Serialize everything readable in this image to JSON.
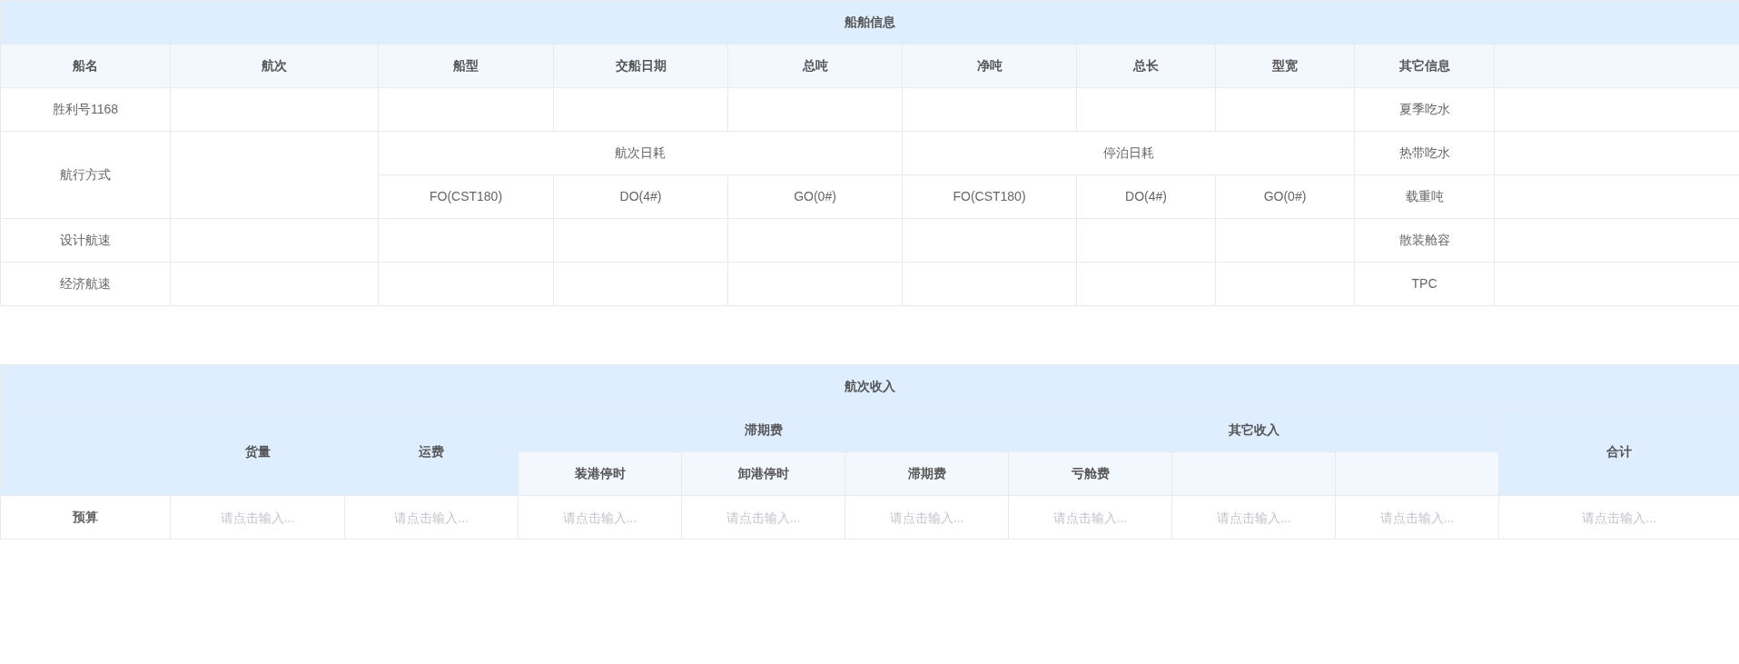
{
  "ship_info": {
    "title": "船舶信息",
    "columns": [
      "船名",
      "航次",
      "船型",
      "交船日期",
      "总吨",
      "净吨",
      "总长",
      "型宽",
      "其它信息"
    ],
    "rows": [
      {
        "kind": "plain",
        "label": "胜利号1168",
        "other": "夏季吃水"
      },
      {
        "kind": "consumption",
        "label": "航行方式",
        "groups": [
          {
            "title": "航次日耗",
            "fuels": [
              "FO(CST180)",
              "DO(4#)",
              "GO(0#)"
            ]
          },
          {
            "title": "停泊日耗",
            "fuels": [
              "FO(CST180)",
              "DO(4#)",
              "GO(0#)"
            ]
          }
        ],
        "others": [
          "热带吃水",
          "载重吨"
        ]
      },
      {
        "kind": "plain",
        "label": "设计航速",
        "other": "散装舱容"
      },
      {
        "kind": "plain",
        "label": "经济航速",
        "other": "TPC"
      }
    ]
  },
  "voyage_income": {
    "title": "航次收入",
    "columns": [
      {
        "kind": "single",
        "label": "货量"
      },
      {
        "kind": "single",
        "label": "运费"
      },
      {
        "kind": "group",
        "label": "滞期费",
        "children": [
          "装港停时",
          "卸港停时",
          "滞期费"
        ]
      },
      {
        "kind": "group",
        "label": "其它收入",
        "children": [
          "亏舱费"
        ]
      },
      {
        "kind": "single",
        "label": "合计"
      }
    ],
    "rows": [
      {
        "label": "预算",
        "fields": [
          {
            "placeholder": "请点击输入..."
          },
          {
            "placeholder": "请点击输入..."
          },
          {
            "placeholder": "请点击输入..."
          },
          {
            "placeholder": "请点击输入..."
          },
          {
            "placeholder": "请点击输入..."
          },
          {
            "placeholder": "请点击输入..."
          },
          {
            "placeholder": "请点击输入..."
          },
          {
            "placeholder": "请点击输入..."
          },
          {
            "placeholder": "请点击输入..."
          }
        ]
      }
    ]
  }
}
